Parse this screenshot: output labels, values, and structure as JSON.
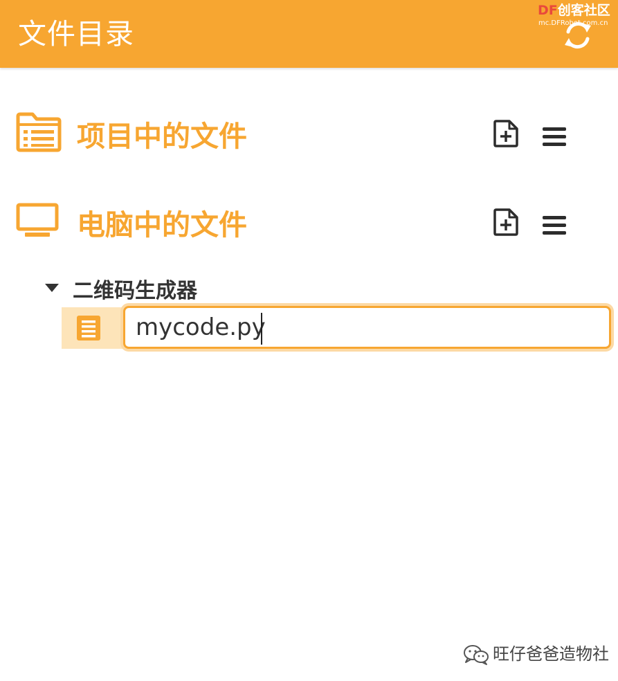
{
  "header": {
    "title": "文件目录"
  },
  "watermark_top": {
    "brand_prefix": "DF",
    "brand_name": "创客社区",
    "url": "mc.DFRobot.com.cn"
  },
  "sections": {
    "project": {
      "title": "项目中的文件"
    },
    "computer": {
      "title": "电脑中的文件"
    }
  },
  "tree": {
    "folder_label": "二维码生成器"
  },
  "rename": {
    "value": "mycode.py"
  },
  "watermark_bottom": {
    "label": "旺仔爸爸造物社"
  },
  "colors": {
    "accent": "#f7a631",
    "file_row_bg": "#fde4b9",
    "icon_dark": "#2c2c2c"
  },
  "icons": {
    "refresh": "refresh-icon",
    "project_folder": "folder-list-icon",
    "computer": "monitor-icon",
    "new_file": "new-file-icon",
    "menu": "menu-icon",
    "caret": "caret-down-icon",
    "file": "file-icon",
    "wechat": "wechat-icon"
  }
}
